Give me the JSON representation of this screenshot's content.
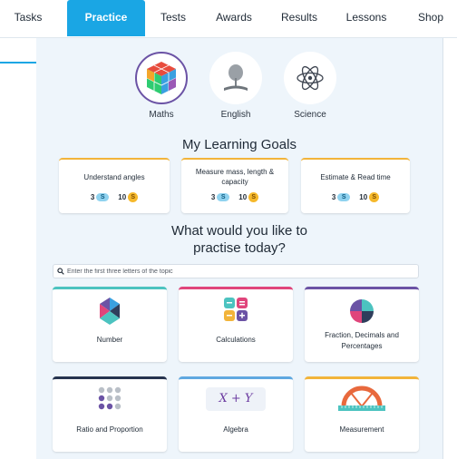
{
  "nav": {
    "tabs": [
      {
        "label": "Tasks",
        "active": false
      },
      {
        "label": "Practice",
        "active": true
      },
      {
        "label": "Tests",
        "active": false
      },
      {
        "label": "Awards",
        "active": false
      },
      {
        "label": "Results",
        "active": false
      },
      {
        "label": "Lessons",
        "active": false
      },
      {
        "label": "Shop",
        "active": false
      }
    ]
  },
  "subjects": [
    {
      "label": "Maths",
      "icon": "rubik-cube-icon",
      "selected": true
    },
    {
      "label": "English",
      "icon": "book-tree-icon",
      "selected": false
    },
    {
      "label": "Science",
      "icon": "atom-icon",
      "selected": false
    }
  ],
  "goals_title": "My Learning Goals",
  "goals": [
    {
      "title": "Understand angles",
      "stars": "3",
      "coins": "10"
    },
    {
      "title": "Measure mass, length & capacity",
      "stars": "3",
      "coins": "10"
    },
    {
      "title": "Estimate & Read time",
      "stars": "3",
      "coins": "10"
    }
  ],
  "coin_symbol": "S",
  "practise_title_line1": "What would you like to",
  "practise_title_line2": "practise today?",
  "search": {
    "placeholder": "Enter the first three letters of the topic"
  },
  "topics": [
    {
      "title": "Number",
      "icon": "number-icon",
      "accent": "#4cc3c0"
    },
    {
      "title": "Calculations",
      "icon": "calculations-icon",
      "accent": "#e0457b"
    },
    {
      "title": "Fraction, Decimals and Percentages",
      "icon": "pie-chart-icon",
      "accent": "#6b53a5"
    },
    {
      "title": "Ratio and Proportion",
      "icon": "dots-grid-icon",
      "accent": "#26344f"
    },
    {
      "title": "Algebra",
      "icon": "algebra-icon",
      "accent": "#5fa8e0"
    },
    {
      "title": "Measurement",
      "icon": "protractor-ruler-icon",
      "accent": "#f2b43a"
    }
  ],
  "algebra_icon_text": "X + Y"
}
